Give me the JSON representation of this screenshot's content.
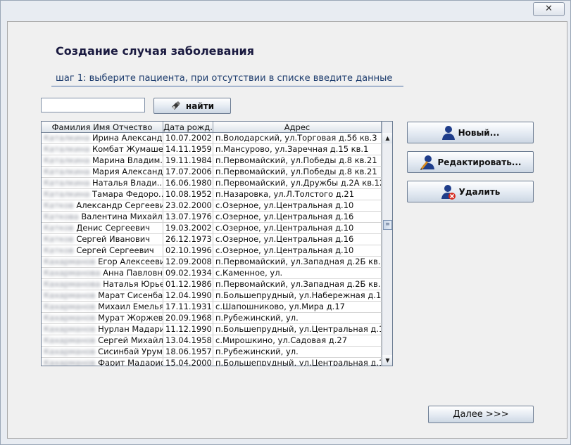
{
  "window": {
    "close_label": "✕"
  },
  "heading": "Создание случая заболевания",
  "step_text": "шаг 1: выберите пациента, при отсутствии в списке введите данные",
  "search": {
    "value": "",
    "placeholder": ""
  },
  "buttons": {
    "find": "найти",
    "new": "Новый...",
    "edit": "Редактировать...",
    "delete": "Удалить",
    "next": "Далее >>>"
  },
  "table": {
    "columns": [
      "Фамилия Имя Отчество",
      "Дата рожд.",
      "Адрес"
    ],
    "rows": [
      {
        "name_blur": "Каталкина",
        "name": "Ирина Александ...",
        "dob": "10.07.2002",
        "addr": "п.Володарский, ул.Торговая д.56 кв.3"
      },
      {
        "name_blur": "Каталкина",
        "name": "Комбат Жумаше...",
        "dob": "14.11.1959",
        "addr": "п.Мансурово, ул.Заречная д.15 кв.1"
      },
      {
        "name_blur": "Каталкина",
        "name": "Марина Владим...",
        "dob": "19.11.1984",
        "addr": "п.Первомайский, ул.Победы д.8 кв.21"
      },
      {
        "name_blur": "Каталкина",
        "name": "Мария Александ...",
        "dob": "17.07.2006",
        "addr": "п.Первомайский, ул.Победы д.8 кв.21"
      },
      {
        "name_blur": "Каталкина",
        "name": "Наталья Влади...",
        "dob": "16.06.1980",
        "addr": "п.Первомайский, ул.Дружбы д.2А кв.12"
      },
      {
        "name_blur": "Каталкина",
        "name": "Тамара Федоро...",
        "dob": "10.08.1952",
        "addr": "п.Назаровка, ул.Л.Толстого д.21"
      },
      {
        "name_blur": "Катков",
        "name": "Александр Сергеевич",
        "dob": "23.02.2000",
        "addr": "с.Озерное, ул.Центральная д.10"
      },
      {
        "name_blur": "Каткова",
        "name": "Валентина Михайлов...",
        "dob": "13.07.1976",
        "addr": "с.Озерное, ул.Центральная д.16"
      },
      {
        "name_blur": "Катков",
        "name": "Денис Сергеевич",
        "dob": "19.03.2002",
        "addr": "с.Озерное, ул.Центральная д.10"
      },
      {
        "name_blur": "Катков",
        "name": "Сергей Иванович",
        "dob": "26.12.1973",
        "addr": "с.Озерное, ул.Центральная д.16"
      },
      {
        "name_blur": "Катков",
        "name": "Сергей Сергеевич",
        "dob": "02.10.1996",
        "addr": "с.Озерное, ул.Центральная д.10"
      },
      {
        "name_blur": "Кахарманов",
        "name": "Егор Алексеевич",
        "dob": "12.09.2008",
        "addr": "п.Первомайский, ул.Западная д.2Б кв.11"
      },
      {
        "name_blur": "Кахарманова",
        "name": "Анна Павловна",
        "dob": "09.02.1934",
        "addr": "с.Каменное, ул."
      },
      {
        "name_blur": "Кахарманова",
        "name": "Наталья Юрьев...",
        "dob": "01.12.1986",
        "addr": "п.Первомайский, ул.Западная д.2Б кв.11"
      },
      {
        "name_blur": "Кахарманов",
        "name": "Марат Сисенбаевич",
        "dob": "12.04.1990",
        "addr": "п.Большепрудный, ул.Набережная д.1"
      },
      {
        "name_blur": "Кахарманов",
        "name": "Михаил Емельянович",
        "dob": "17.11.1931",
        "addr": "с.Шапошниково, ул.Мира д.17"
      },
      {
        "name_blur": "Кахарманов",
        "name": "Мурат Жоржевич",
        "dob": "20.09.1968",
        "addr": "п.Рубежинский, ул."
      },
      {
        "name_blur": "Кахарманов",
        "name": "Нурлан Мадарисович",
        "dob": "11.12.1990",
        "addr": "п.Большепрудный, ул.Центральная д.11"
      },
      {
        "name_blur": "Кахарманов",
        "name": "Сергей Михайлович",
        "dob": "13.04.1958",
        "addr": "с.Мирошкино, ул.Садовая д.27"
      },
      {
        "name_blur": "Кахарманов",
        "name": "Сисинбай Урумгали...",
        "dob": "18.06.1957",
        "addr": "п.Рубежинский, ул."
      },
      {
        "name_blur": "Кахарманов",
        "name": "Фарит Мадарисович",
        "dob": "15.04.2000",
        "addr": "п.Большепрудный, ул.Центральная д.11"
      }
    ]
  },
  "icons": {
    "find": "search-flashlight-icon",
    "new": "user-icon",
    "edit": "user-edit-icon",
    "delete": "user-delete-icon"
  },
  "colors": {
    "heading": "#1a1a40",
    "step": "#1e3d6e",
    "panel": "#f0f0f0"
  }
}
